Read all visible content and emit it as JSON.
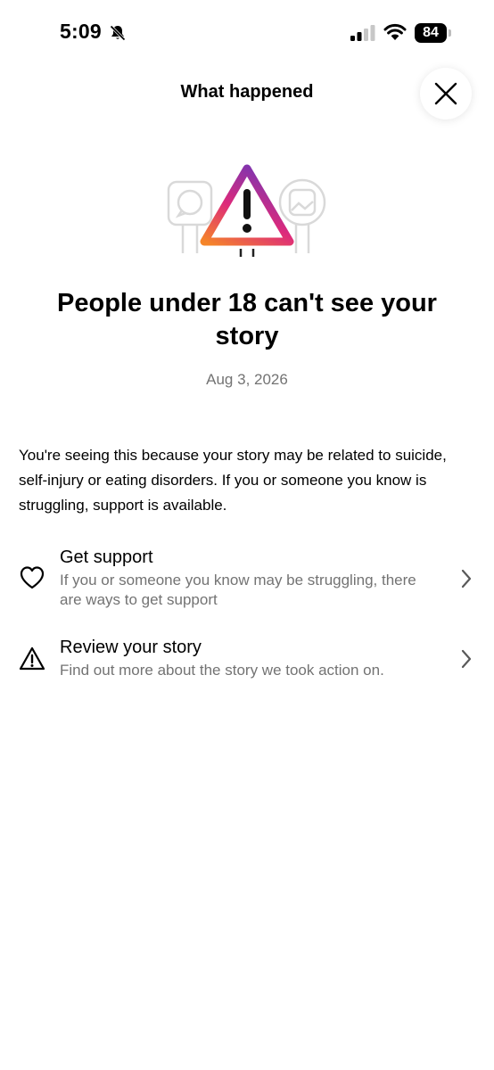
{
  "status_bar": {
    "time": "5:09",
    "battery_level": "84",
    "icons": [
      "bell-slash-icon",
      "cellular-signal-icon",
      "wifi-icon",
      "battery-icon"
    ]
  },
  "header": {
    "title": "What happened",
    "close_icon": "close-icon"
  },
  "illustration": {
    "icon": "warning-triangle-icon",
    "gradient_colors": [
      "#f58529",
      "#dd2a7b",
      "#8134af"
    ]
  },
  "headline": "People under 18 can't see your story",
  "date": "Aug 3, 2026",
  "explanation": "You're seeing this because your story may be related to suicide, self-injury or eating disorders. If you or someone you know is struggling, support is available.",
  "options": [
    {
      "icon": "heart-icon",
      "title": "Get support",
      "description": "If you or someone you know may be struggling, there are ways to get support"
    },
    {
      "icon": "warning-icon",
      "title": "Review your story",
      "description": "Find out more about the story we took action on."
    }
  ]
}
